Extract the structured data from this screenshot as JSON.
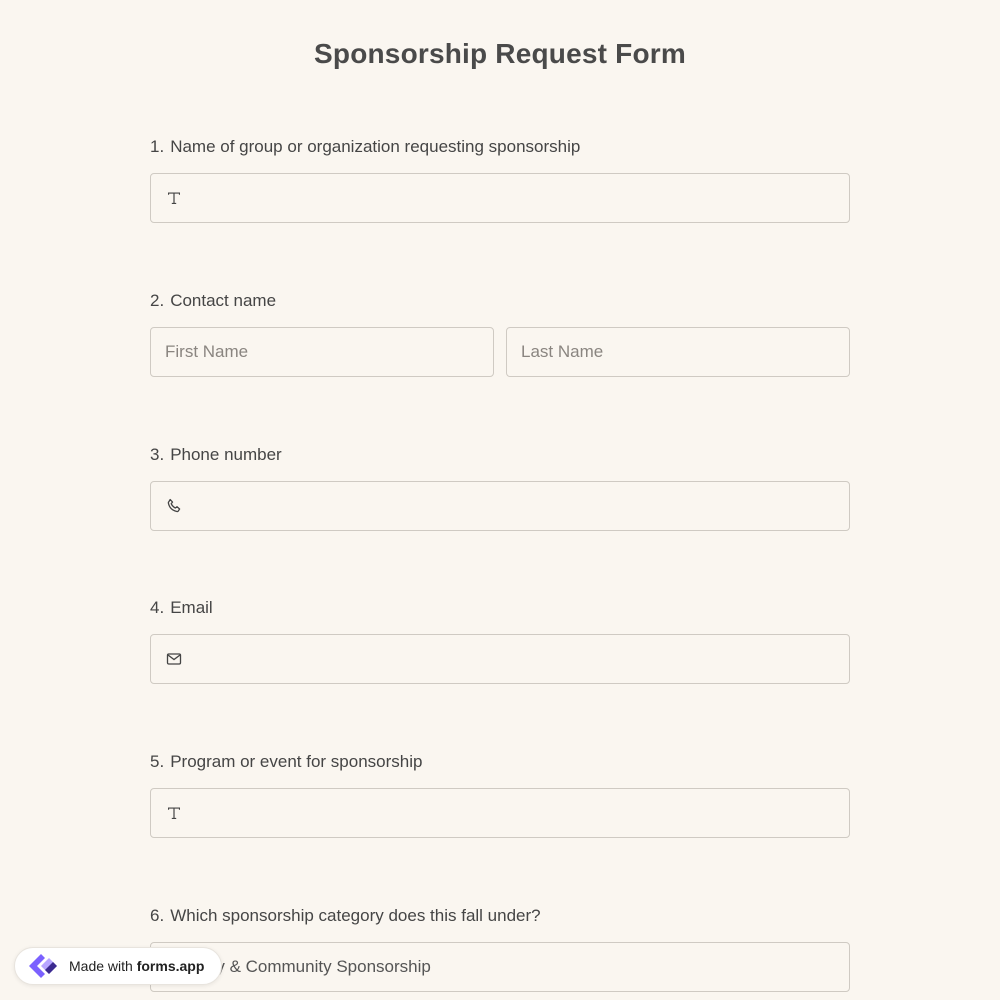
{
  "form": {
    "title": "Sponsorship Request Form"
  },
  "questions": [
    {
      "number": "1.",
      "label": "Name of group or organization requesting sponsorship",
      "icon": "text-icon",
      "value": ""
    },
    {
      "number": "2.",
      "label": "Contact name",
      "first_placeholder": "First Name",
      "last_placeholder": "Last Name"
    },
    {
      "number": "3.",
      "label": "Phone number",
      "icon": "phone-icon",
      "value": ""
    },
    {
      "number": "4.",
      "label": "Email",
      "icon": "mail-icon",
      "value": ""
    },
    {
      "number": "5.",
      "label": "Program or event for sponsorship",
      "icon": "text-icon",
      "value": ""
    },
    {
      "number": "6.",
      "label": "Which sponsorship category does this fall under?",
      "selected": "Charity & Community Sponsorship"
    }
  ],
  "badge": {
    "prefix": "Made with",
    "brand": "forms.app",
    "icon": "forms-app-logo",
    "colors": {
      "primary": "#7b61ff",
      "secondary": "#3b2a8f"
    }
  },
  "colors": {
    "background": "#faf6f0",
    "border": "#cfcac3",
    "text": "#444444"
  }
}
